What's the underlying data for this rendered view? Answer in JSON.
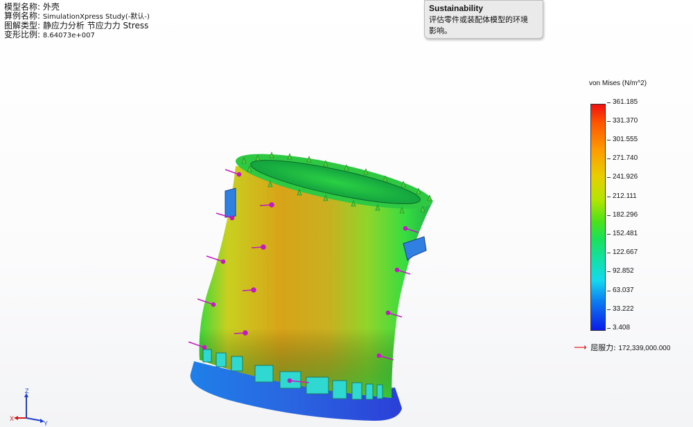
{
  "info": {
    "model_name_label": "模型名称:",
    "model_name": "外壳",
    "study_name_label": "算例名称:",
    "study_name": "SimulationXpress Study(-默认-)",
    "plot_type_label": "图解类型:",
    "plot_type": "静应力分析 节应力力 Stress",
    "deform_scale_label": "变形比例:",
    "deform_scale": "8.64073e+007"
  },
  "tooltip": {
    "title": "Sustainability",
    "line1": "评估零件或装配体模型的环境",
    "line2": "影响。"
  },
  "legend": {
    "title": "von Mises (N/m^2)",
    "ticks": [
      "361.185",
      "331.370",
      "301.555",
      "271.740",
      "241.926",
      "212.111",
      "182.296",
      "152.481",
      "122.667",
      "92.852",
      "63.037",
      "33.222",
      "3.408"
    ],
    "colors": {
      "max": "#ee1111",
      "mid": "#4be21a",
      "min": "#0a1be8"
    }
  },
  "yield": {
    "label": "屈服力:",
    "value": "172,339,000.000"
  },
  "triad": {
    "x": "X",
    "y": "Y",
    "z": "Z"
  }
}
